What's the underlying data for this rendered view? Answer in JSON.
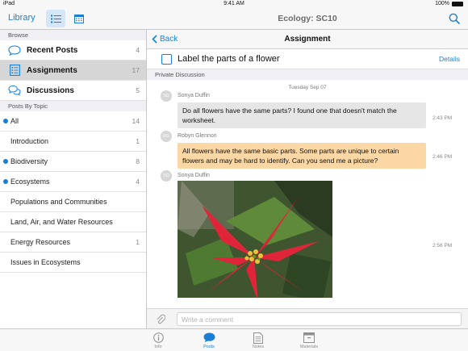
{
  "status_bar": {
    "device": "iPad",
    "time": "9:41 AM",
    "battery": "100%"
  },
  "top_nav": {
    "library_label": "Library",
    "title": "Ecology: SC10"
  },
  "sidebar": {
    "browse_header": "Browse",
    "browse_items": [
      {
        "label": "Recent Posts",
        "count": "4",
        "icon": "chat-bubble-icon"
      },
      {
        "label": "Assignments",
        "count": "17",
        "icon": "assignment-list-icon"
      },
      {
        "label": "Discussions",
        "count": "5",
        "icon": "discussion-bubbles-icon"
      }
    ],
    "topics_header": "Posts By Topic",
    "topics": [
      {
        "label": "All",
        "count": "14",
        "dot": true
      },
      {
        "label": "Introduction",
        "count": "1",
        "dot": false
      },
      {
        "label": "Biodiversity",
        "count": "8",
        "dot": true
      },
      {
        "label": "Ecosystems",
        "count": "4",
        "dot": true
      },
      {
        "label": "Populations and Communities",
        "count": "",
        "dot": false
      },
      {
        "label": "Land, Air, and Water Resources",
        "count": "",
        "dot": false
      },
      {
        "label": "Energy Resources",
        "count": "1",
        "dot": false
      },
      {
        "label": "Issues in Ecosystems",
        "count": "",
        "dot": false
      }
    ]
  },
  "main": {
    "back_label": "Back",
    "title": "Assignment",
    "assignment_title": "Label the parts of a flower",
    "details_label": "Details",
    "private_header": "Private Discussion",
    "date_label": "Tuesday Sep 07",
    "messages": [
      {
        "initials": "SD",
        "sender": "Sonya Duffin",
        "text": "Do all flowers have the same parts? I found one that doesn't match the worksheet.",
        "time": "2:43 PM"
      },
      {
        "initials": "RG",
        "sender": "Robyn Glennon",
        "text": "All flowers have the same basic parts. Some parts are unique to certain flowers and may be hard to identify. Can you send me a picture?",
        "time": "2:46 PM"
      },
      {
        "initials": "SD",
        "sender": "Sonya Duffin",
        "text": "",
        "time": "2:56 PM"
      }
    ],
    "comment_placeholder": "Write a comment"
  },
  "tabs": [
    {
      "label": "Info",
      "icon": "info-icon"
    },
    {
      "label": "Posts",
      "icon": "posts-bubble-icon"
    },
    {
      "label": "Notes",
      "icon": "notes-icon"
    },
    {
      "label": "Materials",
      "icon": "materials-box-icon"
    }
  ],
  "colors": {
    "accent": "#1a7fd4",
    "selected_row": "#d6d6d6",
    "teacher_bubble": "#fbd7a5",
    "student_bubble": "#e6e6e6"
  }
}
